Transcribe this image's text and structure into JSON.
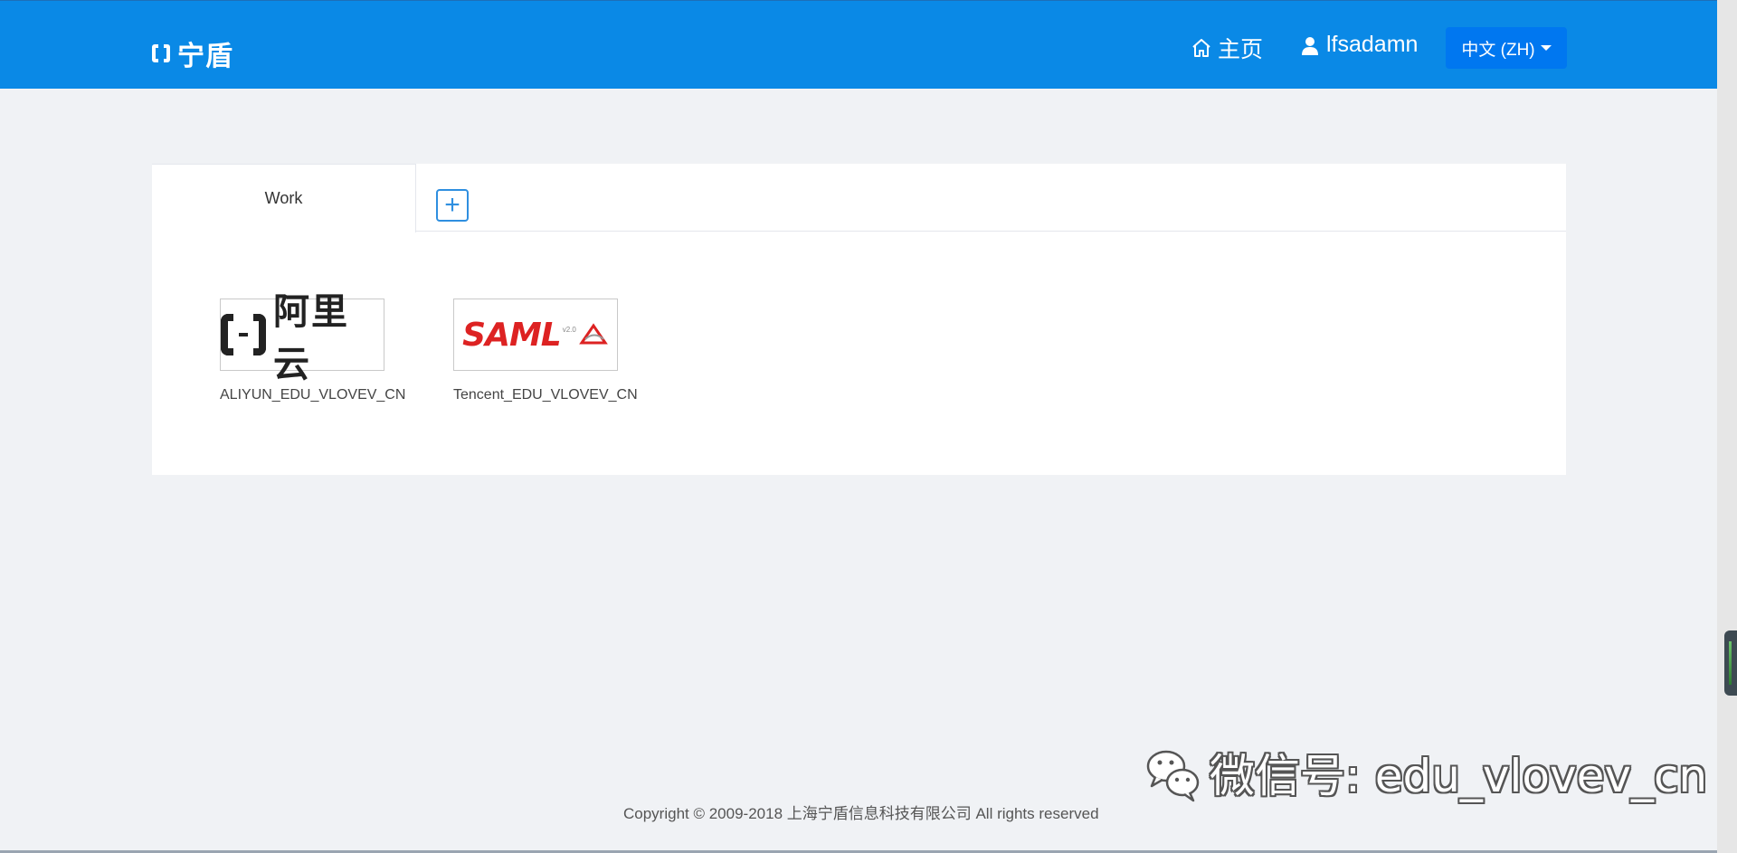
{
  "header": {
    "logo_text": "宁盾",
    "nav_home_label": "主页",
    "nav_user_label": "lfsadamn",
    "language_label": "中文 (ZH)",
    "bg_color": "#0a89e6"
  },
  "tabs": [
    {
      "label": "Work",
      "active": true
    }
  ],
  "add_tab_symbol": "+",
  "apps": [
    {
      "logo_text": "阿里云",
      "label": "ALIYUN_EDU_VLOVEV_CN"
    },
    {
      "logo_text": "SAML",
      "logo_version": "v2.0",
      "label": "Tencent_EDU_VLOVEV_CN"
    }
  ],
  "footer": {
    "copyright": "Copyright © 2009-2018 上海宁盾信息科技有限公司 All rights reserved"
  },
  "watermark": {
    "text": "微信号: edu_vlovev_cn"
  },
  "icons": {
    "home": "home-icon",
    "user": "user-icon",
    "caret": "caret-down-icon",
    "wechat": "wechat-icon"
  }
}
